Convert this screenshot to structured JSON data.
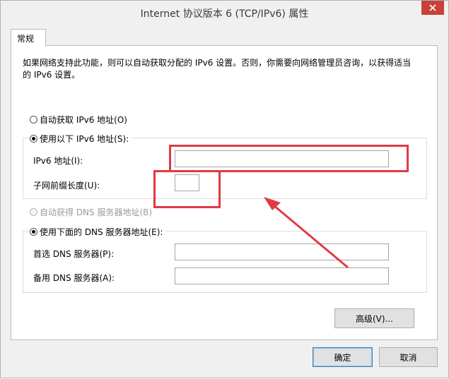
{
  "window": {
    "title": "Internet 协议版本 6 (TCP/IPv6) 属性"
  },
  "tabs": [
    {
      "label": "常规"
    }
  ],
  "description": "如果网络支持此功能，则可以自动获取分配的 IPv6 设置。否则，你需要向网络管理员咨询，以获得适当的 IPv6 设置。",
  "ip": {
    "auto_label": "自动获取 IPv6 地址(O)",
    "manual_label": "使用以下 IPv6 地址(S):",
    "selected": "manual",
    "address_label": "IPv6 地址(I):",
    "address_value": "",
    "prefix_label": "子网前缀长度(U):",
    "prefix_value": ""
  },
  "dns": {
    "auto_label": "自动获得 DNS 服务器地址(B)",
    "auto_enabled": false,
    "manual_label": "使用下面的 DNS 服务器地址(E):",
    "selected": "manual",
    "preferred_label": "首选 DNS 服务器(P):",
    "preferred_value": "",
    "alternate_label": "备用 DNS 服务器(A):",
    "alternate_value": ""
  },
  "buttons": {
    "advanced": "高级(V)...",
    "ok": "确定",
    "cancel": "取消"
  },
  "annotation": {
    "color": "#e03a46"
  }
}
